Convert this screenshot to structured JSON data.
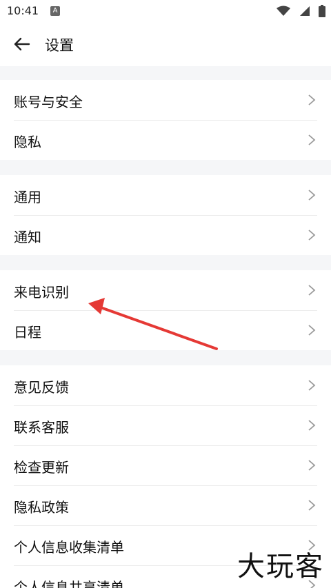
{
  "status": {
    "time": "10:41",
    "notif_badge": "A"
  },
  "header": {
    "title": "设置"
  },
  "groups": [
    {
      "items": [
        {
          "label": "账号与安全"
        },
        {
          "label": "隐私"
        }
      ]
    },
    {
      "items": [
        {
          "label": "通用"
        },
        {
          "label": "通知"
        }
      ]
    },
    {
      "items": [
        {
          "label": "来电识别"
        },
        {
          "label": "日程"
        }
      ]
    },
    {
      "items": [
        {
          "label": "意见反馈"
        },
        {
          "label": "联系客服"
        },
        {
          "label": "检查更新"
        },
        {
          "label": "隐私政策"
        },
        {
          "label": "个人信息收集清单"
        },
        {
          "label": "个人信息共享清单"
        }
      ]
    }
  ],
  "watermark": "大玩客",
  "colors": {
    "arrow": "#e53935",
    "background": "#f5f6f8",
    "chevron": "#9a9a9a"
  }
}
